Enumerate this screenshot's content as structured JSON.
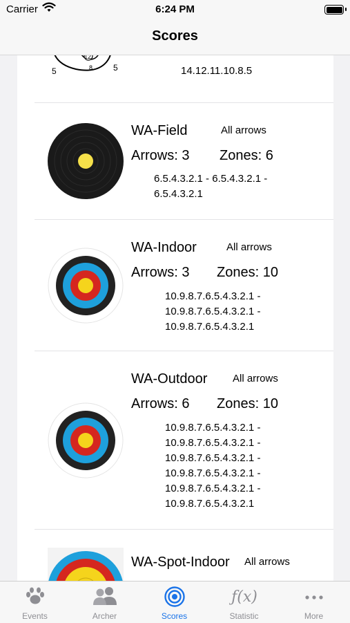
{
  "status_bar": {
    "carrier": "Carrier",
    "time": "6:24 PM"
  },
  "nav": {
    "title": "Scores"
  },
  "partial_row": {
    "label_12": "12",
    "label_8": "8",
    "label_5_left": "5",
    "label_5_right": "5",
    "zones": "14.12.11.10.8.5"
  },
  "scores": [
    {
      "name": "WA-Field",
      "scope": "All arrows",
      "arrows": "Arrows: 3",
      "zones_count": "Zones: 6",
      "zones": [
        "6.5.4.3.2.1 - 6.5.4.3.2.1 -",
        "6.5.4.3.2.1"
      ]
    },
    {
      "name": "WA-Indoor",
      "scope": "All arrows",
      "arrows": "Arrows: 3",
      "zones_count": "Zones: 10",
      "zones": [
        "10.9.8.7.6.5.4.3.2.1 -",
        "10.9.8.7.6.5.4.3.2.1 -",
        "10.9.8.7.6.5.4.3.2.1"
      ]
    },
    {
      "name": "WA-Outdoor",
      "scope": "All arrows",
      "arrows": "Arrows: 6",
      "zones_count": "Zones: 10",
      "zones": [
        "10.9.8.7.6.5.4.3.2.1 -",
        "10.9.8.7.6.5.4.3.2.1 -",
        "10.9.8.7.6.5.4.3.2.1 -",
        "10.9.8.7.6.5.4.3.2.1 -",
        "10.9.8.7.6.5.4.3.2.1 -",
        "10.9.8.7.6.5.4.3.2.1"
      ]
    },
    {
      "name": "WA-Spot-Indoor",
      "scope": "All arrows"
    }
  ],
  "tabbar": {
    "items": [
      {
        "label": "Events",
        "icon": "paw-icon"
      },
      {
        "label": "Archer",
        "icon": "people-icon"
      },
      {
        "label": "Scores",
        "icon": "target-icon",
        "active": true
      },
      {
        "label": "Statistic",
        "icon": "function-icon"
      },
      {
        "label": "More",
        "icon": "more-icon"
      }
    ]
  },
  "colors": {
    "active_tab": "#1a73e8",
    "inactive_tab": "#8e8e93",
    "target_yellow": "#f5d41c",
    "target_red": "#d5271f",
    "target_blue": "#1ea0dc"
  }
}
